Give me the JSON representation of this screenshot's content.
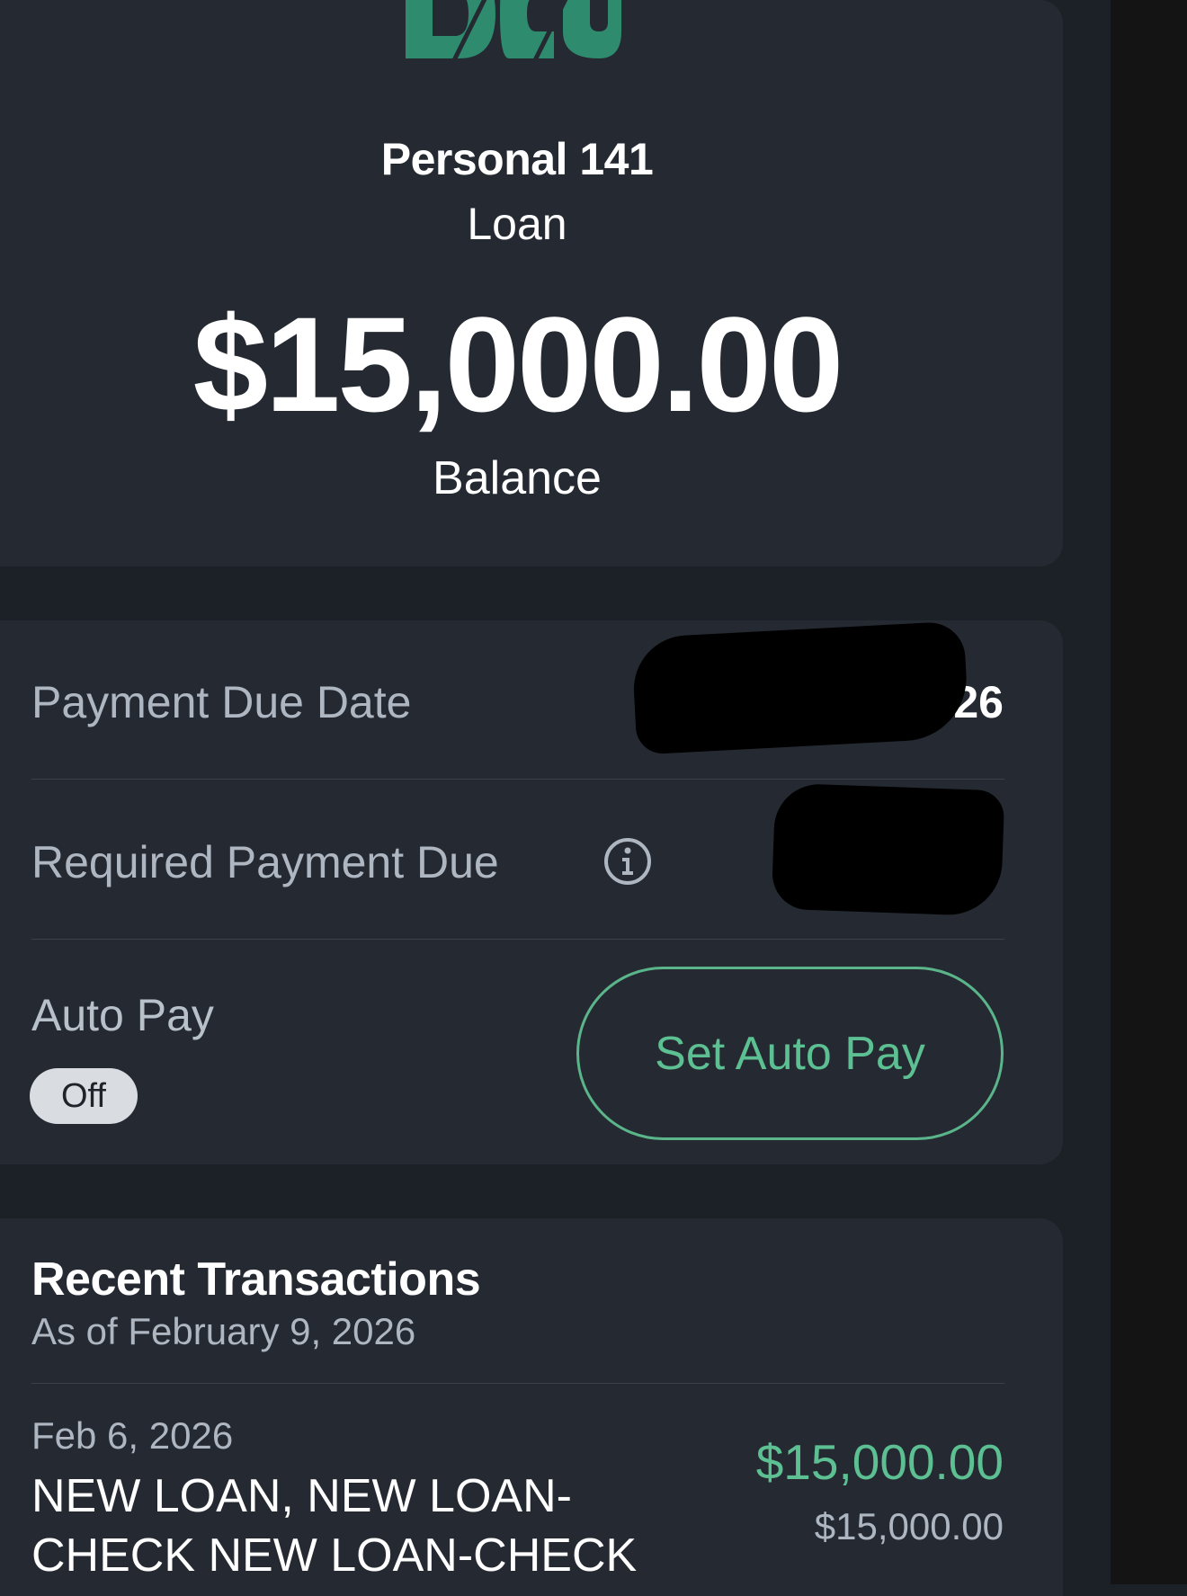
{
  "logo": {
    "name": "DCU"
  },
  "account": {
    "name": "Personal 141",
    "type": "Loan",
    "balance": "$15,000.00",
    "balance_label": "Balance"
  },
  "details": {
    "payment_due_date_label": "Payment Due Date",
    "payment_due_date_value_visible": "26",
    "required_payment_label": "Required Payment Due",
    "auto_pay_label": "Auto Pay",
    "auto_pay_status": "Off",
    "set_auto_pay_label": "Set Auto Pay"
  },
  "transactions": {
    "title": "Recent Transactions",
    "as_of": "As of February 9, 2026",
    "items": [
      {
        "date": "Feb 6, 2026",
        "description": "NEW LOAN, NEW LOAN-CHECK NEW LOAN-CHECK",
        "amount": "$15,000.00",
        "balance": "$15,000.00"
      }
    ]
  },
  "colors": {
    "background": "#1c2127",
    "card": "#252a32",
    "accent_green": "#5cc093",
    "muted_text": "#aeb6c1"
  },
  "icons": {
    "info": "info-icon"
  }
}
